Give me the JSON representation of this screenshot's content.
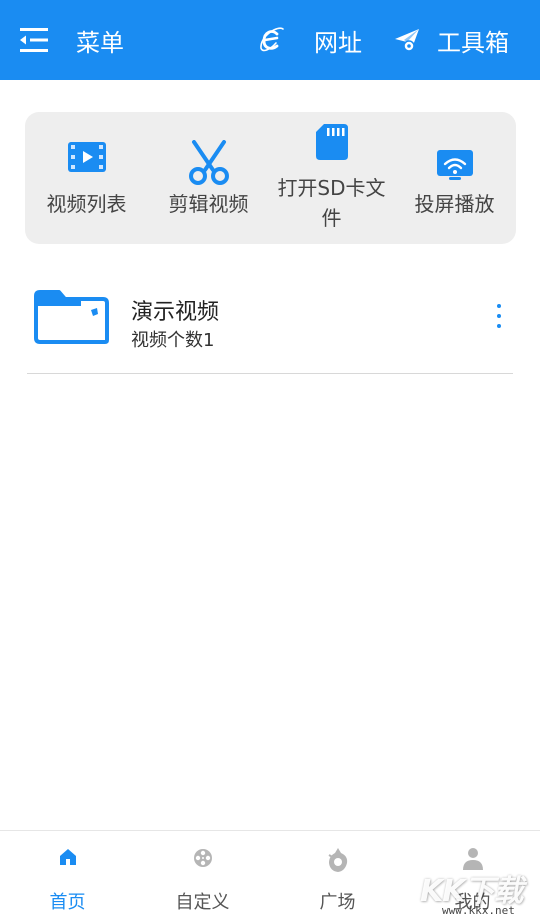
{
  "header": {
    "menu_label": "菜单",
    "url_label": "网址",
    "toolbox_label": "工具箱",
    "background": "#1a8cf2"
  },
  "quick_actions": [
    {
      "label": "视频列表",
      "icon": "video-list-icon"
    },
    {
      "label": "剪辑视频",
      "icon": "scissors-icon"
    },
    {
      "label_line1": "打开SD卡文",
      "label_line2": "件",
      "icon": "sd-card-icon"
    },
    {
      "label": "投屏播放",
      "icon": "cast-screen-icon"
    }
  ],
  "list": {
    "items": [
      {
        "title": "演示视频",
        "subtitle": "视频个数1",
        "icon": "folder-icon"
      }
    ]
  },
  "bottom_nav": {
    "items": [
      {
        "label": "首页",
        "icon": "home-icon",
        "active": true
      },
      {
        "label": "自定义",
        "icon": "film-reel-icon",
        "active": false
      },
      {
        "label": "广场",
        "icon": "plaza-icon",
        "active": false
      },
      {
        "label": "我的",
        "icon": "user-icon",
        "active": false
      }
    ]
  },
  "watermark": {
    "text": "KK下载",
    "url": "www.kkx.net"
  },
  "colors": {
    "accent": "#1a8cf2",
    "panel": "#eeeeee",
    "inactive_icon": "#b5b5b5"
  }
}
